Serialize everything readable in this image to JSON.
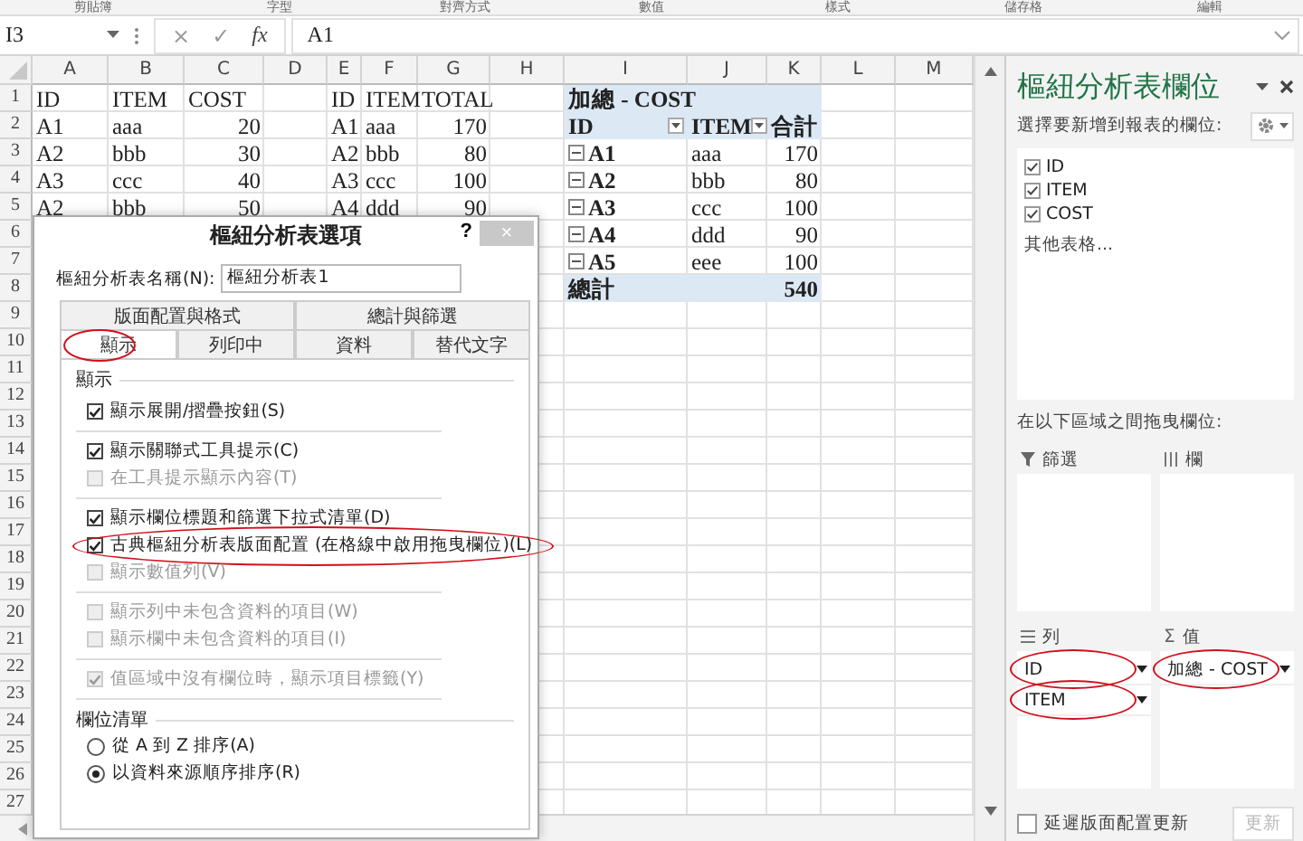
{
  "ribbon_groups": [
    "剪貼簿",
    "字型",
    "對齊方式",
    "數值",
    "樣式",
    "儲存格",
    "編輯"
  ],
  "formula_bar": {
    "name_box": "I3",
    "cancel": "×",
    "enter": "✓",
    "function": "fx",
    "formula": "A1"
  },
  "sheet": {
    "columns": [
      "A",
      "B",
      "C",
      "D",
      "E",
      "F",
      "G",
      "H",
      "I",
      "J",
      "K",
      "L",
      "M"
    ],
    "row_numbers": [
      "1",
      "2",
      "3",
      "4",
      "5",
      "6",
      "7",
      "8",
      "9",
      "10",
      "11",
      "12",
      "13",
      "14",
      "15",
      "16",
      "17",
      "18",
      "19",
      "20",
      "21",
      "22",
      "23",
      "24",
      "25",
      "26",
      "27"
    ],
    "source_table": [
      [
        "ID",
        "ITEM",
        "COST"
      ],
      [
        "A1",
        "aaa",
        "20"
      ],
      [
        "A2",
        "bbb",
        "30"
      ],
      [
        "A3",
        "ccc",
        "40"
      ],
      [
        "A2",
        "bbb",
        "50"
      ]
    ],
    "summary_table": [
      [
        "ID",
        "ITEM",
        "TOTAL"
      ],
      [
        "A1",
        "aaa",
        "170"
      ],
      [
        "A2",
        "bbb",
        "80"
      ],
      [
        "A3",
        "ccc",
        "100"
      ],
      [
        "A4",
        "ddd",
        "90"
      ]
    ],
    "pivot": {
      "title": "加總 - COST",
      "fields": [
        {
          "label": "ID",
          "filter": true
        },
        {
          "label": "ITEM",
          "filter": true
        },
        {
          "label": "合計",
          "filter": false
        }
      ],
      "rows": [
        {
          "id": "A1",
          "item": "aaa",
          "total": "170"
        },
        {
          "id": "A2",
          "item": "bbb",
          "total": "80"
        },
        {
          "id": "A3",
          "item": "ccc",
          "total": "100"
        },
        {
          "id": "A4",
          "item": "ddd",
          "total": "90"
        },
        {
          "id": "A5",
          "item": "eee",
          "total": "100"
        }
      ],
      "grand_total": {
        "label": "總計",
        "value": "540"
      }
    }
  },
  "dialog": {
    "title": "樞紐分析表選項",
    "help": "?",
    "close": "×",
    "name_label": "樞紐分析表名稱(N):",
    "name_value": "樞紐分析表1",
    "tab_rows": [
      [
        {
          "label": "版面配置與格式",
          "selected": false,
          "circled": false
        },
        {
          "label": "總計與篩選",
          "selected": false,
          "circled": false
        }
      ],
      [
        {
          "label": "顯示",
          "selected": true,
          "circled": true
        },
        {
          "label": "列印中",
          "selected": false,
          "circled": false
        },
        {
          "label": "資料",
          "selected": false,
          "circled": false
        },
        {
          "label": "替代文字",
          "selected": false,
          "circled": false
        }
      ]
    ],
    "section": "顯示",
    "option_groups": [
      [
        {
          "label": "顯示展開/摺疊按鈕(S)",
          "checked": true,
          "disabled": false,
          "circled": false
        }
      ],
      [
        {
          "label": "顯示關聯式工具提示(C)",
          "checked": true,
          "disabled": false,
          "circled": false
        },
        {
          "label": "在工具提示顯示內容(T)",
          "checked": false,
          "disabled": true,
          "circled": false
        }
      ],
      [
        {
          "label": "顯示欄位標題和篩選下拉式清單(D)",
          "checked": true,
          "disabled": false,
          "circled": false
        },
        {
          "label": "古典樞紐分析表版面配置 (在格線中啟用拖曳欄位)(L)",
          "checked": true,
          "disabled": false,
          "circled": true
        },
        {
          "label": "顯示數值列(V)",
          "checked": false,
          "disabled": true,
          "circled": false
        }
      ],
      [
        {
          "label": "顯示列中未包含資料的項目(W)",
          "checked": false,
          "disabled": true,
          "circled": false
        },
        {
          "label": "顯示欄中未包含資料的項目(I)",
          "checked": false,
          "disabled": true,
          "circled": false
        }
      ],
      [
        {
          "label": "值區域中沒有欄位時，顯示項目標籤(Y)",
          "checked": true,
          "disabled": true,
          "circled": false
        }
      ]
    ],
    "list_section": "欄位清單",
    "sort_options": [
      {
        "label": "從 A 到 Z 排序(A)",
        "selected": false
      },
      {
        "label": "以資料來源順序排序(R)",
        "selected": true
      }
    ]
  },
  "field_pane": {
    "title": "樞紐分析表欄位",
    "choose_label": "選擇要新增到報表的欄位:",
    "fields": [
      {
        "label": "ID",
        "checked": true
      },
      {
        "label": "ITEM",
        "checked": true
      },
      {
        "label": "COST",
        "checked": true
      }
    ],
    "more_tables": "其他表格...",
    "drag_label": "在以下區域之間拖曳欄位:",
    "areas": [
      {
        "kind": "filter",
        "label": "篩選"
      },
      {
        "kind": "columns",
        "label": "欄"
      },
      {
        "kind": "rows",
        "label": "列",
        "chips": [
          {
            "label": "ID",
            "circled": true
          },
          {
            "label": "ITEM",
            "circled": true
          }
        ]
      },
      {
        "kind": "values",
        "symbol": "Σ",
        "label": "值",
        "chips": [
          {
            "label": "加總 - COST",
            "circled": true
          }
        ]
      }
    ],
    "defer": {
      "label": "延遲版面配置更新",
      "checked": false
    },
    "update": {
      "label": "更新",
      "disabled": true
    }
  }
}
